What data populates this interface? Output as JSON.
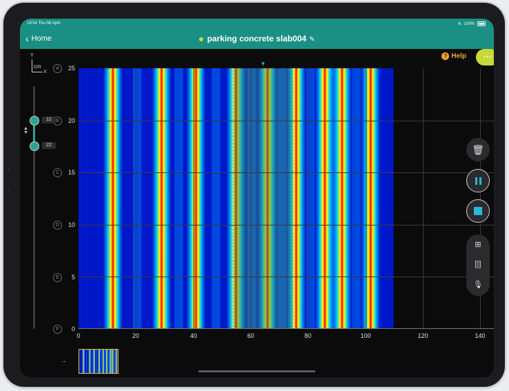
{
  "status_bar": {
    "time": "19:54 Thu 08 April",
    "battery": "100%"
  },
  "nav": {
    "back_label": "Home",
    "title": "parking concrete slab004"
  },
  "toolbar": {
    "help_label": "Help",
    "more_label": "···"
  },
  "axis_indicator": {
    "y": "Y",
    "unit": "cm",
    "x": "X"
  },
  "row_labels": [
    "A",
    "B",
    "C",
    "D",
    "E",
    "F"
  ],
  "y_ticks": [
    "25",
    "20",
    "15",
    "10",
    "5",
    "0"
  ],
  "x_ticks": [
    "0",
    "20",
    "40",
    "60",
    "80",
    "100",
    "120",
    "140"
  ],
  "slider": {
    "upper_value": "12",
    "lower_value": "22"
  },
  "controls": [
    "trash-icon",
    "pause-icon",
    "stop-icon",
    "layout-icon",
    "split-icon",
    "microphone-icon"
  ],
  "chart_data": {
    "type": "heatmap",
    "x_range": [
      0,
      145
    ],
    "y_range": [
      0,
      25
    ],
    "scan_extent_x": [
      0,
      110
    ],
    "selection_x": [
      54,
      75
    ],
    "hot_bands_x": [
      12,
      29,
      41,
      55,
      66,
      76,
      86,
      92,
      102
    ],
    "colormap": [
      "#0018c8",
      "#0080ff",
      "#00e0ff",
      "#ffff00",
      "#ff0000"
    ]
  }
}
